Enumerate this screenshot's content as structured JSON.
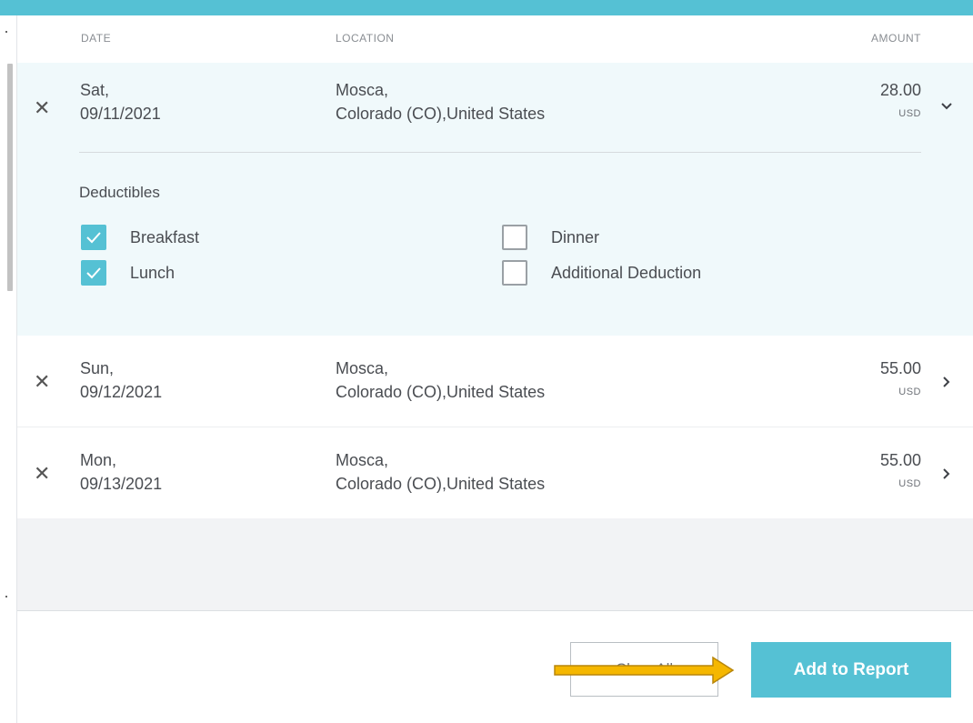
{
  "headers": {
    "date": "DATE",
    "location": "LOCATION",
    "amount": "AMOUNT"
  },
  "rows": [
    {
      "day": "Sat,",
      "date": "09/11/2021",
      "location_line1": "Mosca,",
      "location_line2": "Colorado (CO),United States",
      "amount": "28.00",
      "currency": "USD",
      "expanded": true
    },
    {
      "day": "Sun,",
      "date": "09/12/2021",
      "location_line1": "Mosca,",
      "location_line2": "Colorado (CO),United States",
      "amount": "55.00",
      "currency": "USD",
      "expanded": false
    },
    {
      "day": "Mon,",
      "date": "09/13/2021",
      "location_line1": "Mosca,",
      "location_line2": "Colorado (CO),United States",
      "amount": "55.00",
      "currency": "USD",
      "expanded": false
    }
  ],
  "deductibles": {
    "title": "Deductibles",
    "items": [
      {
        "label": "Breakfast",
        "checked": true
      },
      {
        "label": "Lunch",
        "checked": true
      },
      {
        "label": "Dinner",
        "checked": false
      },
      {
        "label": "Additional Deduction",
        "checked": false
      }
    ]
  },
  "footer": {
    "clear_label": "Clear All",
    "add_label": "Add to Report"
  },
  "colors": {
    "accent": "#55c1d4",
    "expanded_bg": "#f0f9fb",
    "arrow": "#f5b700"
  },
  "icons": [
    "close-icon",
    "chevron-down-icon",
    "chevron-right-icon",
    "checkmark-icon",
    "arrow-annotation"
  ]
}
